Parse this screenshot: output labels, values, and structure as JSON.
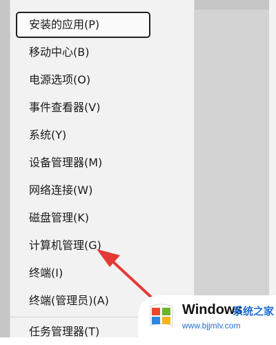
{
  "menu": {
    "items": [
      {
        "label": "安装的应用(P)",
        "focused": true
      },
      {
        "label": "移动中心(B)"
      },
      {
        "label": "电源选项(O)"
      },
      {
        "label": "事件查看器(V)"
      },
      {
        "label": "系统(Y)"
      },
      {
        "label": "设备管理器(M)"
      },
      {
        "label": "网络连接(W)"
      },
      {
        "label": "磁盘管理(K)"
      },
      {
        "label": "计算机管理(G)"
      },
      {
        "label": "终端(I)"
      },
      {
        "label": "终端(管理员)(A)"
      },
      {
        "label": "任务管理器(T)"
      }
    ]
  },
  "watermark": {
    "title": "Windows",
    "site_cn": "系统之家",
    "url": "www.bjjmlv.com"
  },
  "colors": {
    "arrow": "#e53935",
    "watermark_blue": "#1e6fd0"
  }
}
